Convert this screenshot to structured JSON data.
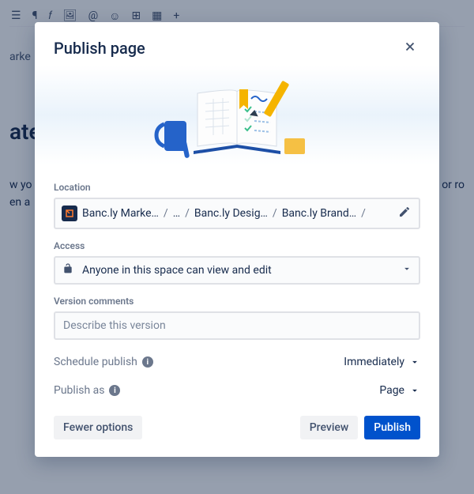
{
  "background": {
    "breadcrumb_partial": "arke",
    "heading_partial": "ate",
    "body_line1": "w yo",
    "body_line2": "en a",
    "body_right1": ", or ro"
  },
  "modal": {
    "title": "Publish page",
    "location": {
      "label": "Location",
      "crumbs": [
        "Banc.ly Marke…",
        "…",
        "Banc.ly Desig…",
        "Banc.ly Brand…"
      ]
    },
    "access": {
      "label": "Access",
      "value": "Anyone in this space can view and edit"
    },
    "version": {
      "label": "Version comments",
      "placeholder": "Describe this version"
    },
    "schedule": {
      "label": "Schedule publish",
      "value": "Immediately"
    },
    "publish_as": {
      "label": "Publish as",
      "value": "Page"
    },
    "buttons": {
      "fewer": "Fewer options",
      "preview": "Preview",
      "publish": "Publish"
    }
  }
}
